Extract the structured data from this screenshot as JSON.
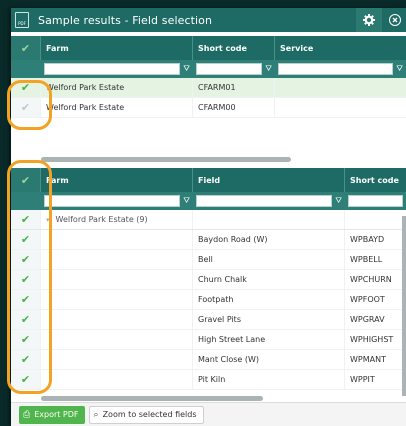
{
  "window": {
    "title": "Sample results - Field selection",
    "pdf_icon_text": "PDF"
  },
  "farm_grid": {
    "columns": [
      "Farm",
      "Short code",
      "Service"
    ],
    "rows": [
      {
        "farm": "Welford Park Estate",
        "code": "CFARM01",
        "service": "",
        "selected": true
      },
      {
        "farm": "Welford Park Estate",
        "code": "CFARM00",
        "service": "",
        "selected": false
      }
    ]
  },
  "field_grid": {
    "columns": [
      "Farm",
      "Field",
      "Short code"
    ],
    "group": "Welford Park Estate (9)",
    "rows": [
      {
        "field": "Baydon Road (W)",
        "code": "WPBAYD"
      },
      {
        "field": "Bell",
        "code": "WPBELL"
      },
      {
        "field": "Churn Chalk",
        "code": "WPCHURN"
      },
      {
        "field": "Footpath",
        "code": "WPFOOT"
      },
      {
        "field": "Gravel Pits",
        "code": "WPGRAV"
      },
      {
        "field": "High Street Lane",
        "code": "WPHIGHST"
      },
      {
        "field": "Mant Close (W)",
        "code": "WPMANT"
      },
      {
        "field": "Pit Kiln",
        "code": "WPPIT"
      }
    ]
  },
  "footer": {
    "export_label": "Export PDF",
    "zoom_label": "Zoom to selected fields"
  },
  "colors": {
    "header": "#1d6b64",
    "check": "#47b34a",
    "highlight": "#f2a324"
  }
}
